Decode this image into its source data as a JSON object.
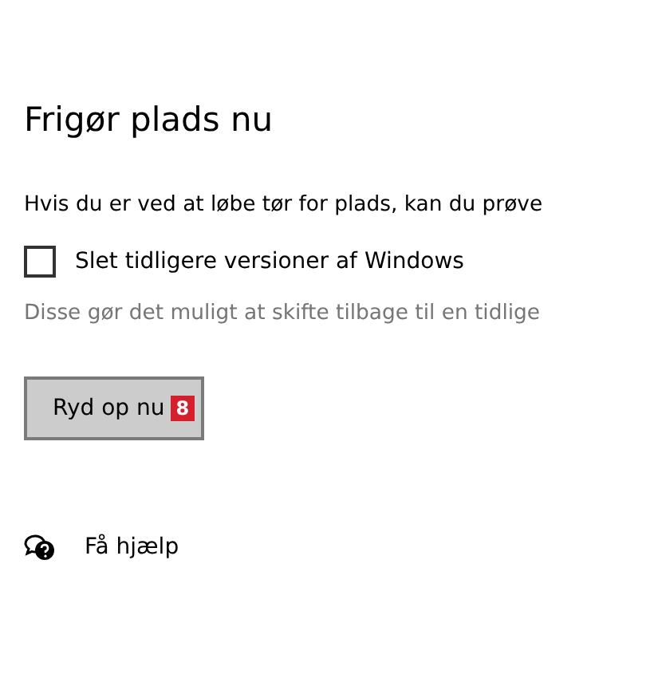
{
  "title": "Frigør plads nu",
  "intro": "Hvis du er ved at løbe tør for plads, kan du prøve",
  "option": {
    "label": "Slet tidligere versioner af Windows",
    "checked": false
  },
  "description": "Disse gør det muligt at skifte tilbage til en tidlige",
  "button": {
    "label": "Ryd op nu",
    "badge": "8"
  },
  "help_link": "Få hjælp"
}
